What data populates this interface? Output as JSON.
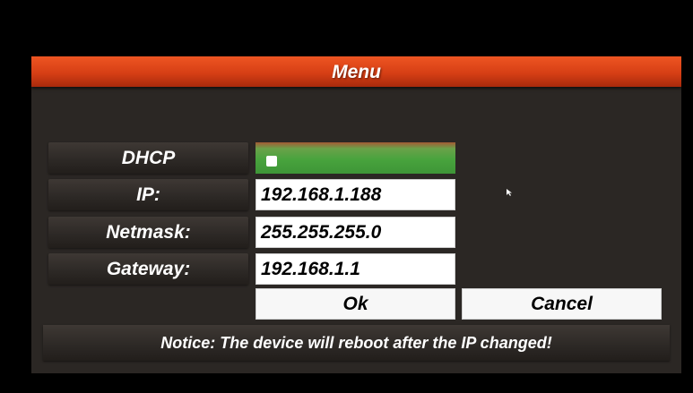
{
  "dialog": {
    "title": "Menu",
    "accent_color": "#d63f15"
  },
  "form": {
    "dhcp": {
      "label": "DHCP",
      "toggle_on": true,
      "toggle_color": "#48a33d"
    },
    "ip": {
      "label": "IP:",
      "value": "192.168.1.188"
    },
    "netmask": {
      "label": "Netmask:",
      "value": "255.255.255.0"
    },
    "gateway": {
      "label": "Gateway:",
      "value": "192.168.1.1"
    }
  },
  "buttons": {
    "ok_label": "Ok",
    "cancel_label": "Cancel"
  },
  "notice": "Notice: The device will reboot after the IP changed!",
  "icons": [
    "mouse-pointer-icon"
  ]
}
